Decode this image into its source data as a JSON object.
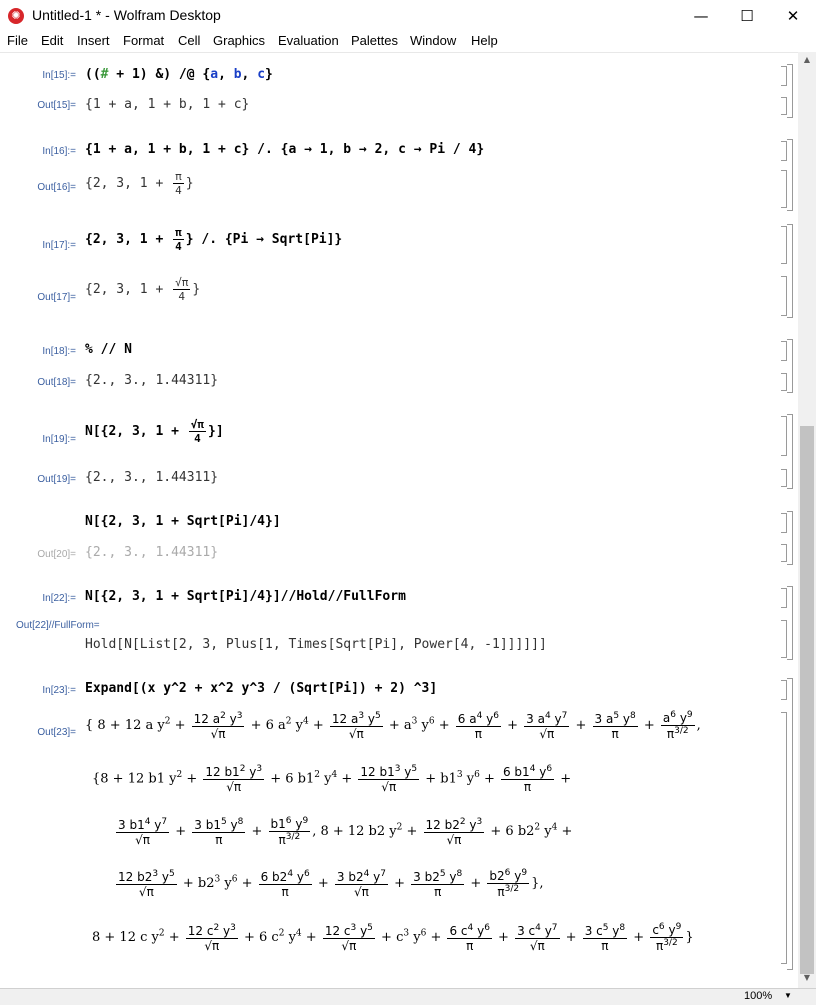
{
  "window": {
    "title": "Untitled-1 * - Wolfram Desktop",
    "minimize": "—",
    "maximize": "☐",
    "close": "✕"
  },
  "menu": [
    "File",
    "Edit",
    "Insert",
    "Format",
    "Cell",
    "Graphics",
    "Evaluation",
    "Palettes",
    "Window",
    "Help"
  ],
  "cells": {
    "in15": {
      "label": "In[15]:=",
      "text": "((# + 1) &) /@ {a, b, c}"
    },
    "out15": {
      "label": "Out[15]=",
      "text": "{1 + a, 1 + b, 1 + c}"
    },
    "in16": {
      "label": "In[16]:=",
      "text": "{1 + a, 1 + b, 1 + c} /. {a → 1, b → 2, c → Pi / 4}"
    },
    "out16": {
      "label": "Out[16]=",
      "pre": "{2, 3, 1 + ",
      "num": "π",
      "den": "4",
      "post": "}"
    },
    "in17": {
      "label": "In[17]:=",
      "pre": "{2, 3, 1 + ",
      "num": "π",
      "den": "4",
      "post": "} /. {Pi → Sqrt[Pi]}"
    },
    "out17": {
      "label": "Out[17]=",
      "pre": "{2, 3, 1 + ",
      "num": "√π",
      "den": "4",
      "post": "}"
    },
    "in18": {
      "label": "In[18]:=",
      "text": "% // N"
    },
    "out18": {
      "label": "Out[18]=",
      "text": "{2., 3., 1.44311}"
    },
    "in19": {
      "label": "In[19]:=",
      "pre": "N[{2, 3, 1 + ",
      "num": "√π",
      "den": "4",
      "post": "}]"
    },
    "out19": {
      "label": "Out[19]=",
      "text": "{2., 3., 1.44311}"
    },
    "in20": {
      "text": "N[{2, 3, 1 + Sqrt[Pi]/4}]"
    },
    "out20": {
      "label": "Out[20]=",
      "text": "{2., 3., 1.44311}"
    },
    "in22": {
      "label": "In[22]:=",
      "text": "N[{2, 3, 1 + Sqrt[Pi]/4}]//Hold//FullForm"
    },
    "out22": {
      "label": "Out[22]//FullForm=",
      "text": "Hold[N[List[2, 3, Plus[1, Times[Sqrt[Pi], Power[4, -1]]]]]]"
    },
    "in23": {
      "label": "In[23]:=",
      "text": "Expand[(x y^2 + x^2 y^3 / (Sqrt[Pi]) + 2) ^3]"
    },
    "out23": {
      "label": "Out[23]="
    }
  },
  "status": {
    "zoom": "100%"
  }
}
